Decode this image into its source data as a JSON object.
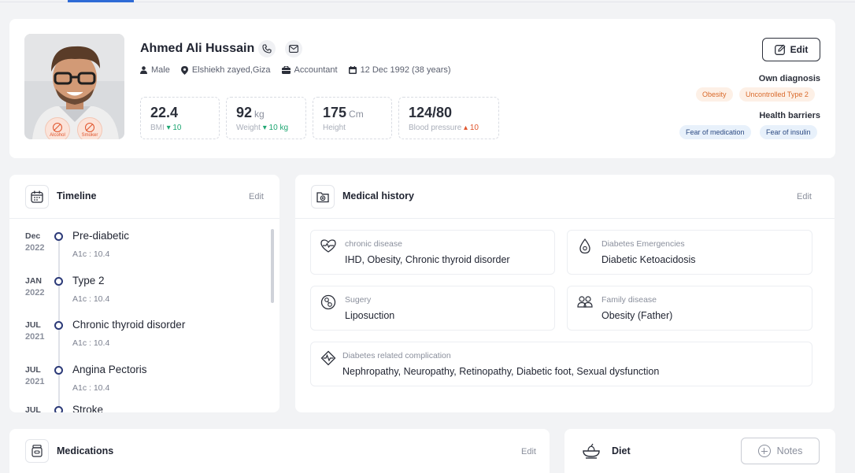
{
  "patient": {
    "name": "Ahmed Ali Hussain",
    "gender": "Male",
    "location": "Elshiekh zayed,Giza",
    "job": "Accountant",
    "dob": "12 Dec 1992 (38 years)",
    "badges": [
      "Alcohol",
      "Smoker"
    ]
  },
  "stats": [
    {
      "value": "22.4",
      "unit": "",
      "label": "BMI",
      "delta": "10",
      "dir": "down"
    },
    {
      "value": "92",
      "unit": "kg",
      "label": "Weight",
      "delta": "10 kg",
      "dir": "down"
    },
    {
      "value": "175",
      "unit": "Cm",
      "label": "Height",
      "delta": "",
      "dir": ""
    },
    {
      "value": "124/80",
      "unit": "",
      "label": "Blood pressure",
      "delta": "10",
      "dir": "up"
    }
  ],
  "profile_edit": "Edit",
  "own_diagnosis": {
    "label": "Own diagnosis",
    "tags": [
      "Obesity",
      "Uncontrolled Type 2"
    ]
  },
  "health_barriers": {
    "label": "Health barriers",
    "tags": [
      "Fear of medication",
      "Fear of insulin"
    ]
  },
  "timeline": {
    "title": "Timeline",
    "edit": "Edit",
    "items": [
      {
        "month": "Dec",
        "year": "2022",
        "title": "Pre-diabetic",
        "sub": "A1c : 10.4"
      },
      {
        "month": "JAN",
        "year": "2022",
        "title": "Type 2",
        "sub": "A1c : 10.4"
      },
      {
        "month": "JUL",
        "year": "2021",
        "title": "Chronic thyroid disorder",
        "sub": "A1c : 10.4"
      },
      {
        "month": "JUL",
        "year": "2021",
        "title": "Angina Pectoris",
        "sub": "A1c : 10.4"
      },
      {
        "month": "JUL",
        "year": "",
        "title": "Stroke",
        "sub": ""
      }
    ]
  },
  "history": {
    "title": "Medical history",
    "edit": "Edit",
    "chronic": {
      "label": "chronic disease",
      "value": "IHD, Obesity, Chronic thyroid disorder"
    },
    "emergencies": {
      "label": "Diabetes Emergencies",
      "value": "Diabetic Ketoacidosis"
    },
    "surgery": {
      "label": "Sugery",
      "value": "Liposuction"
    },
    "family": {
      "label": "Family disease",
      "value": "Obesity (Father)"
    },
    "complication": {
      "label": "Diabetes related complication",
      "value": "Nephropathy, Neuropathy, Retinopathy, Diabetic foot,  Sexual dysfunction"
    }
  },
  "medications": {
    "title": "Medications",
    "edit": "Edit"
  },
  "diet": {
    "title": "Diet",
    "notes": "Notes"
  },
  "colors": {
    "accent": "#2f6bd6",
    "navy": "#2c3a78",
    "orange": "#e0542c",
    "green": "#1ea672"
  }
}
